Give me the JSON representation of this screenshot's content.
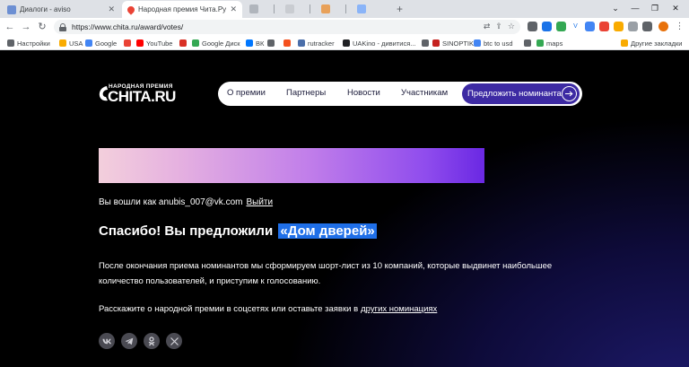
{
  "browser": {
    "tabs": [
      {
        "title": "Диалоги - aviso",
        "icon_color": "#6c8fd3",
        "active": false
      },
      {
        "title": "Народная премия Чита.Ру в Чита",
        "icon_color": "#ea4335",
        "active": true
      }
    ],
    "url": "https://www.chita.ru/award/votes/",
    "bookmarks": [
      {
        "label": "Настройки",
        "icon_color": "#5f6368"
      },
      {
        "label": "USA",
        "icon_color": "#f9ab00"
      },
      {
        "label": "Google",
        "icon_color": "#4285f4"
      },
      {
        "label": "",
        "icon_color": "#ea4335"
      },
      {
        "label": "YouTube",
        "icon_color": "#ff0000"
      },
      {
        "label": "",
        "icon_color": "#d93025"
      },
      {
        "label": "Google Диск",
        "icon_color": "#34a853"
      },
      {
        "label": "ВК",
        "icon_color": "#0077ff"
      },
      {
        "label": "",
        "icon_color": "#5f6368"
      },
      {
        "label": "",
        "icon_color": "#f4511e"
      },
      {
        "label": "rutracker",
        "icon_color": "#4a6ea9"
      },
      {
        "label": "UAKino - дивитися...",
        "icon_color": "#202124"
      },
      {
        "label": "",
        "icon_color": "#5f6368"
      },
      {
        "label": "SINOPTIK",
        "icon_color": "#c5221f"
      },
      {
        "label": "btc to usd",
        "icon_color": "#4285f4"
      },
      {
        "label": "",
        "icon_color": "#5f6368"
      },
      {
        "label": "maps",
        "icon_color": "#34a853"
      },
      {
        "label": "Другие закладки",
        "icon_color": "#f9ab00"
      }
    ]
  },
  "site": {
    "logo_small": "НАРОДНАЯ ПРЕМИЯ",
    "logo_main": "CHITA.RU",
    "nav": [
      "О премии",
      "Партнеры",
      "Новости",
      "Участникам"
    ],
    "cta": "Предложить номинанта",
    "logged_prefix": "Вы вошли как anubis_007@vk.com",
    "logout": "Выйти",
    "thanks_prefix": "Спасибо! Вы предложили",
    "nominee": "«Дом дверей»",
    "paragraph": "После окончания приема номинантов мы сформируем шорт-лист из 10 компаний, которые выдвинет наибольшее количество пользователей, и приступим к голосованию.",
    "share_prefix": "Расскажите о народной премии в соцсетях или оставьте заявки в",
    "share_link": "других номинациях",
    "social": [
      "vk-icon",
      "telegram-icon",
      "odnoklassniki-icon",
      "x-icon"
    ]
  },
  "colors": {
    "menu_text": "#1b1b3a",
    "cta_bg": "#3d2aa3",
    "highlight": "#1f6fe8"
  }
}
